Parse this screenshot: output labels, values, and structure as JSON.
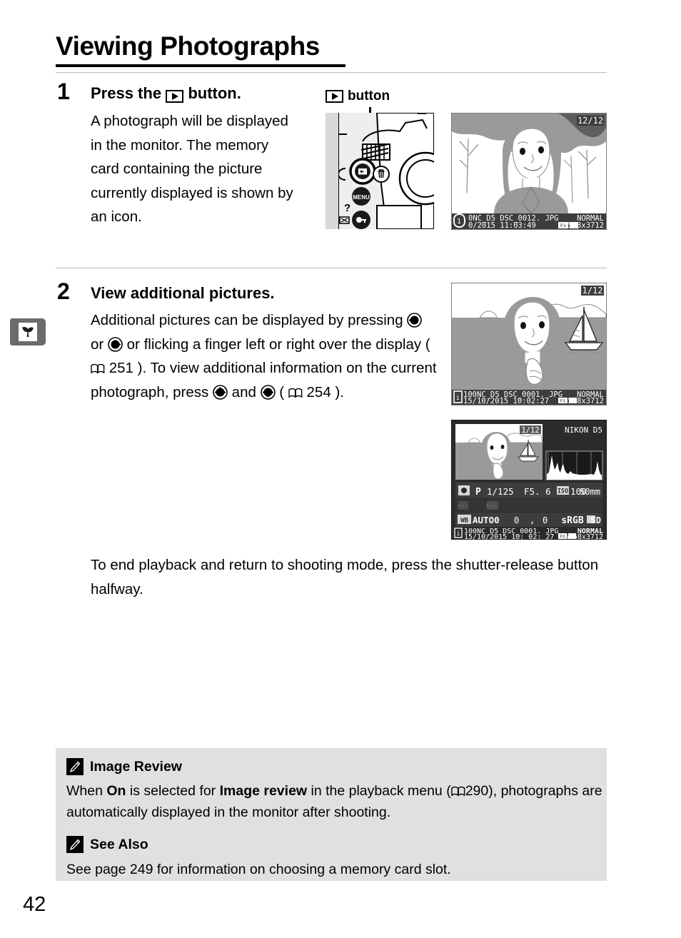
{
  "page": {
    "title": "Viewing Photographs",
    "number": "42",
    "side_tab_icon": "seedling-icon"
  },
  "steps": [
    {
      "number": "1",
      "heading_before": "Press the",
      "heading_icon": "playback-icon",
      "heading_after": "button.",
      "body": "A photograph will be displayed in the monitor. The memory card containing the picture currently displayed is shown by an icon."
    },
    {
      "number": "2",
      "heading": "View additional pictures.",
      "body_part1": "Additional pictures can be displayed by pressing",
      "icon_left": "multi-selector-left-icon",
      "body_or": "or",
      "icon_right": "multi-selector-right-icon",
      "body_part2": "or flicking a finger left or right over the display (",
      "ref_icon_1": "book-icon",
      "ref_page_1": "251",
      "body_part3": ").  To view additional information on the current photograph, press",
      "icon_up": "multi-selector-up-icon",
      "body_and": "and",
      "icon_down": "multi-selector-down-icon",
      "body_part4": "(",
      "ref_icon_2": "book-icon",
      "ref_page_2": "254",
      "body_part5": ")."
    }
  ],
  "closing_paragraph": "To end playback and return to shooting mode, press the shutter-release button halfway.",
  "callout": {
    "icon": "playback-icon",
    "label": "button"
  },
  "screens": {
    "screen1": {
      "frame_counter": "12/12",
      "slot_icon": "card-slot-1-icon",
      "folder": "0NC_D5",
      "filename": "DSC_0012. JPG",
      "quality": "NORMAL",
      "date": "0/2015",
      "time": "11:03:49",
      "area_icon": "FX",
      "size_icon": "image-size-icon",
      "dimensions": "5568x3712"
    },
    "screen2": {
      "frame_counter": "1/12",
      "slot_icon": "card-slot-1-icon",
      "folder": "100NC_D5",
      "filename": "DSC_0001. JPG",
      "quality": "NORMAL",
      "date": "15/10/2015",
      "time": "10:02:27",
      "area_icon": "FX",
      "size_icon": "image-size-icon",
      "dimensions": "5568x3712"
    },
    "screen3": {
      "frame_counter": "1/12",
      "camera_name": "NIKON D5",
      "metering_icon": "matrix-metering-icon",
      "mode": "P",
      "shutter": "1/125",
      "aperture": "F5. 6",
      "iso_label": "ISO",
      "iso_value": "100",
      "focal_length": "50mm",
      "exp_comp_icon": "exposure-compensation-icon",
      "flash_comp_icon": "flash-compensation-icon",
      "wb_label": "WB",
      "wb_value": "AUTO0",
      "wb_fine1": "0",
      "wb_sep": ",",
      "wb_fine2": "0",
      "color_space": "sRGB",
      "picture_control_icon": "picture-control-icon",
      "picture_control": "SD",
      "slot_icon": "card-slot-1-icon",
      "folder": "100NC_D5",
      "filename": "DSC_0001. JPG",
      "quality": "NORMAL",
      "date": "15/10/2015",
      "time": "10: 02: 27",
      "area_icon": "FX",
      "size_icon": "image-size-icon",
      "dimensions": "5568x3712"
    }
  },
  "notes": [
    {
      "icon": "pencil-icon",
      "heading": "Image Review",
      "text_part1": "When ",
      "bold1": "On",
      "text_part2": " is selected for ",
      "bold2": "Image review",
      "text_part3": " in the playback menu (",
      "ref_icon": "book-icon",
      "ref_page": "290",
      "text_part4": "), photographs are automatically displayed in the monitor after shooting."
    },
    {
      "icon": "pencil-icon",
      "heading": "See Also",
      "text": "See page 249 for information on choosing a memory card slot."
    }
  ],
  "colors": {
    "note_bg": "#e0e0e0",
    "tab_gray": "#6b6b6b",
    "screen_dark": "#2b2b2b",
    "screen_mid": "#9a9a9a"
  }
}
